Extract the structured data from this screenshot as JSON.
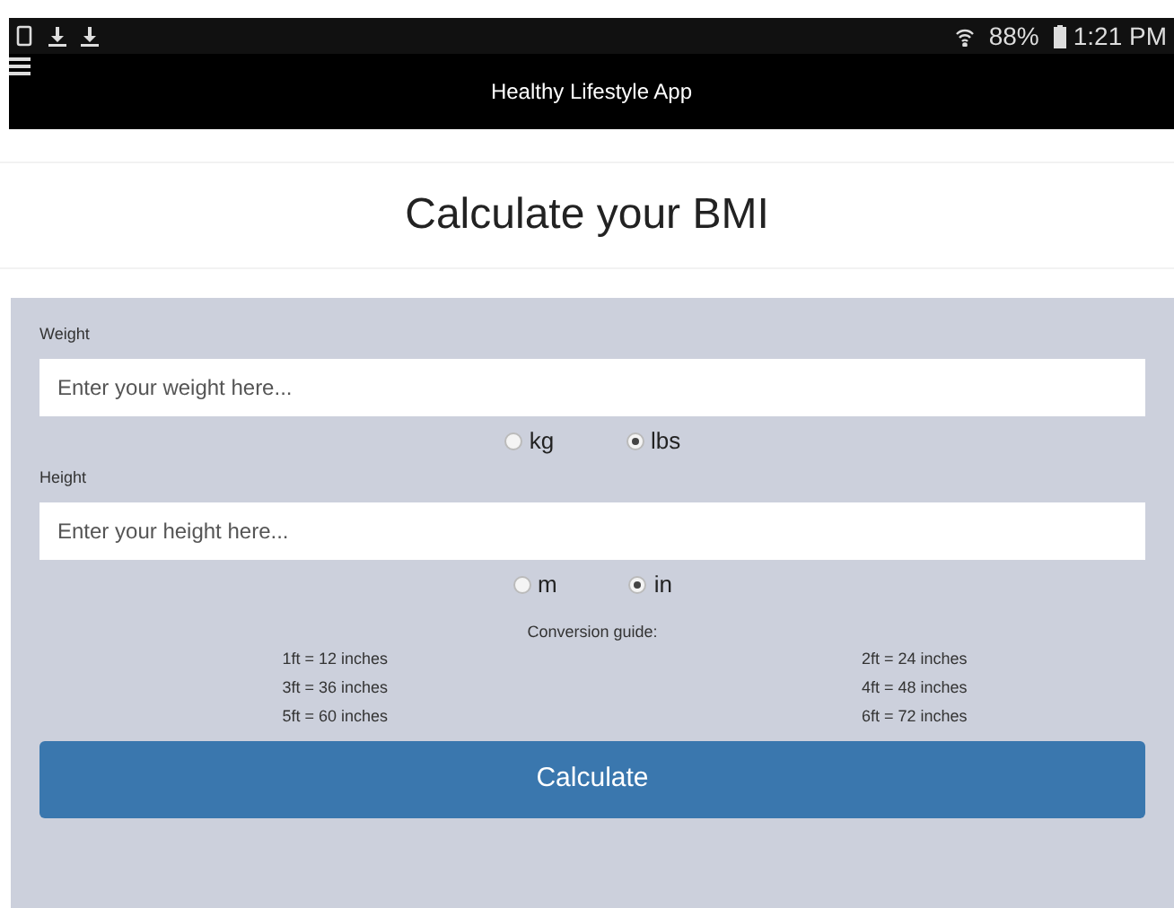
{
  "status_bar": {
    "battery": "88%",
    "time": "1:21 PM"
  },
  "app_bar": {
    "title": "Healthy Lifestyle App"
  },
  "heading": "Calculate your BMI",
  "fields": [
    {
      "label": "Weight",
      "placeholder": "Enter your weight here...",
      "units": [
        {
          "label": "kg",
          "selected": false
        },
        {
          "label": "lbs",
          "selected": true
        }
      ]
    },
    {
      "label": "Height",
      "placeholder": "Enter your height here...",
      "units": [
        {
          "label": "m",
          "selected": false
        },
        {
          "label": "in",
          "selected": true
        }
      ]
    }
  ],
  "guide": {
    "title": "Conversion guide:",
    "rows": [
      [
        "1ft = 12 inches",
        "2ft = 24 inches"
      ],
      [
        "3ft = 36 inches",
        "4ft = 48 inches"
      ],
      [
        "5ft = 60 inches",
        "6ft = 72 inches"
      ]
    ]
  },
  "button": "Calculate"
}
